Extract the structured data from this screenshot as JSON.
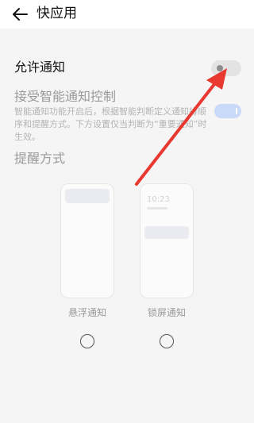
{
  "header": {
    "title": "快应用"
  },
  "allow_notifications": {
    "label": "允许通知",
    "enabled": false
  },
  "smart_control": {
    "title": "接受智能通知控制",
    "description": "智能通知功能开启后，根据智能判断定义通知排顺序和提醒方式。下方设置仅当判断为“重要通知”时生效。",
    "enabled": true
  },
  "reminder": {
    "title": "提醒方式",
    "options": [
      {
        "label": "悬浮通知",
        "selected": false
      },
      {
        "label": "锁屏通知",
        "selected": false,
        "preview_time": "10:23"
      }
    ]
  },
  "colors": {
    "annotation_arrow": "#e8382f",
    "toggle_off": "#e3e3e3",
    "toggle_on_disabled": "#c9d9f8"
  },
  "icons": {
    "back": "arrow-left-icon",
    "annotation": "red-arrow"
  }
}
